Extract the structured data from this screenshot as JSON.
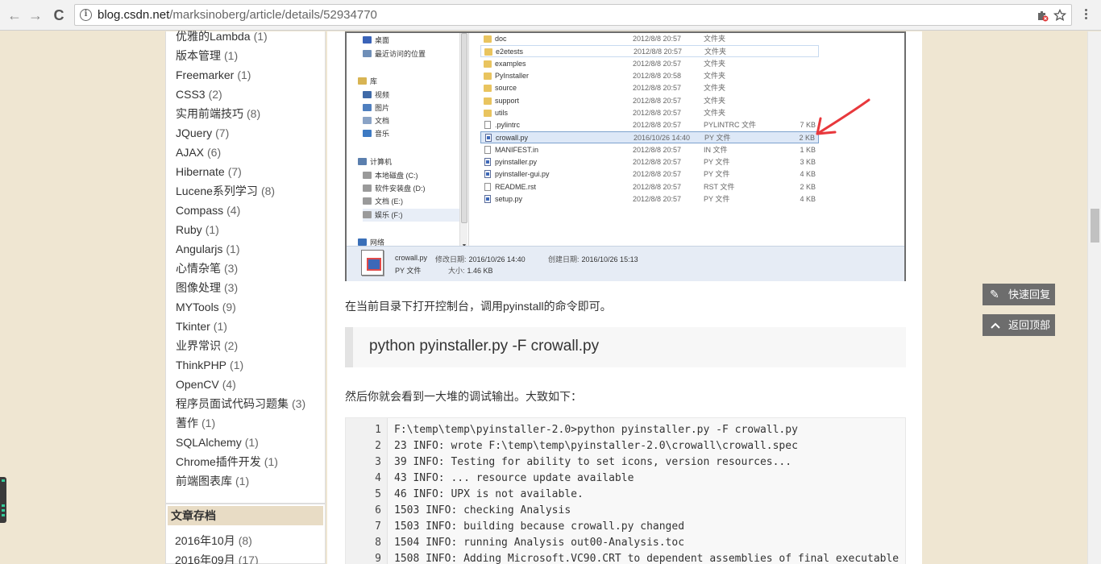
{
  "browser": {
    "url_host": "blog.csdn.net",
    "url_path": "/marksinoberg/article/details/52934770",
    "back_icon": "←",
    "forward_icon": "→",
    "reload_icon": "C"
  },
  "sidebar": {
    "categories": [
      {
        "name": "优雅的Lambda",
        "count": "(1)"
      },
      {
        "name": "版本管理",
        "count": "(1)"
      },
      {
        "name": "Freemarker",
        "count": "(1)"
      },
      {
        "name": "CSS3",
        "count": "(2)"
      },
      {
        "name": "实用前端技巧",
        "count": "(8)"
      },
      {
        "name": "JQuery",
        "count": "(7)"
      },
      {
        "name": "AJAX",
        "count": "(6)"
      },
      {
        "name": "Hibernate",
        "count": "(7)"
      },
      {
        "name": "Lucene系列学习",
        "count": "(8)"
      },
      {
        "name": "Compass",
        "count": "(4)"
      },
      {
        "name": "Ruby",
        "count": "(1)"
      },
      {
        "name": "Angularjs",
        "count": "(1)"
      },
      {
        "name": "心情杂笔",
        "count": "(3)"
      },
      {
        "name": "图像处理",
        "count": "(3)"
      },
      {
        "name": "MYTools",
        "count": "(9)"
      },
      {
        "name": "Tkinter",
        "count": "(1)"
      },
      {
        "name": "业界常识",
        "count": "(2)"
      },
      {
        "name": "ThinkPHP",
        "count": "(1)"
      },
      {
        "name": "OpenCV",
        "count": "(4)"
      },
      {
        "name": "程序员面试代码习题集",
        "count": "(3)"
      },
      {
        "name": "蓍作",
        "count": "(1)"
      },
      {
        "name": "SQLAlchemy",
        "count": "(1)"
      },
      {
        "name": "Chrome插件开发",
        "count": "(1)"
      },
      {
        "name": "前端图表库",
        "count": "(1)"
      }
    ],
    "archive_title": "文章存档",
    "archive": [
      {
        "name": "2016年10月",
        "count": "(8)"
      },
      {
        "name": "2016年09月",
        "count": "(17)"
      }
    ]
  },
  "explorer": {
    "nav": [
      {
        "label": "桌面",
        "icon": "desktop-icon",
        "color": "#3a63b8"
      },
      {
        "label": "最近访问的位置",
        "icon": "recent-places-icon",
        "color": "#6f8fb8"
      },
      {
        "label": "库",
        "icon": "library-icon",
        "color": "#d8b453"
      },
      {
        "label": "视频",
        "icon": "video-icon",
        "color": "#3f6aa8"
      },
      {
        "label": "图片",
        "icon": "pictures-icon",
        "color": "#4f7fbf"
      },
      {
        "label": "文档",
        "icon": "documents-icon",
        "color": "#8aa3c6"
      },
      {
        "label": "音乐",
        "icon": "music-icon",
        "color": "#3d7ac3"
      },
      {
        "label": "计算机",
        "icon": "computer-icon",
        "color": "#5b7fae"
      },
      {
        "label": "本地磁盘 (C:)",
        "icon": "drive-icon",
        "color": "#9a9a9a"
      },
      {
        "label": "软件安装盘 (D:)",
        "icon": "drive-icon",
        "color": "#9a9a9a"
      },
      {
        "label": "文档 (E:)",
        "icon": "drive-icon",
        "color": "#9a9a9a"
      },
      {
        "label": "娱乐 (F:)",
        "icon": "drive-icon",
        "color": "#9a9a9a"
      },
      {
        "label": "网络",
        "icon": "network-icon",
        "color": "#3a6fb8"
      }
    ],
    "files": [
      {
        "name": "doc",
        "date": "2012/8/8 20:57",
        "type": "文件夹",
        "size": "",
        "kind": "folder"
      },
      {
        "name": "e2etests",
        "date": "2012/8/8 20:57",
        "type": "文件夹",
        "size": "",
        "kind": "folder"
      },
      {
        "name": "examples",
        "date": "2012/8/8 20:57",
        "type": "文件夹",
        "size": "",
        "kind": "folder"
      },
      {
        "name": "PyInstaller",
        "date": "2012/8/8 20:58",
        "type": "文件夹",
        "size": "",
        "kind": "folder"
      },
      {
        "name": "source",
        "date": "2012/8/8 20:57",
        "type": "文件夹",
        "size": "",
        "kind": "folder"
      },
      {
        "name": "support",
        "date": "2012/8/8 20:57",
        "type": "文件夹",
        "size": "",
        "kind": "folder"
      },
      {
        "name": "utils",
        "date": "2012/8/8 20:57",
        "type": "文件夹",
        "size": "",
        "kind": "folder"
      },
      {
        "name": ".pylintrc",
        "date": "2012/8/8 20:57",
        "type": "PYLINTRC 文件",
        "size": "7 KB",
        "kind": "file"
      },
      {
        "name": "crowall.py",
        "date": "2016/10/26 14:40",
        "type": "PY 文件",
        "size": "2 KB",
        "kind": "py"
      },
      {
        "name": "MANIFEST.in",
        "date": "2012/8/8 20:57",
        "type": "IN 文件",
        "size": "1 KB",
        "kind": "file"
      },
      {
        "name": "pyinstaller.py",
        "date": "2012/8/8 20:57",
        "type": "PY 文件",
        "size": "3 KB",
        "kind": "py"
      },
      {
        "name": "pyinstaller-gui.py",
        "date": "2012/8/8 20:57",
        "type": "PY 文件",
        "size": "4 KB",
        "kind": "py"
      },
      {
        "name": "README.rst",
        "date": "2012/8/8 20:57",
        "type": "RST 文件",
        "size": "2 KB",
        "kind": "file"
      },
      {
        "name": "setup.py",
        "date": "2012/8/8 20:57",
        "type": "PY 文件",
        "size": "4 KB",
        "kind": "py"
      }
    ],
    "details": {
      "filename": "crowall.py",
      "modified_label": "修改日期:",
      "modified": "2016/10/26 14:40",
      "created_label": "创建日期:",
      "created": "2016/10/26 15:13",
      "filetype": "PY 文件",
      "size_label": "大小:",
      "size": "1.46 KB"
    },
    "arrow_color": "#e8383c"
  },
  "article": {
    "para1": "在当前目录下打开控制台，调用pyinstall的命令即可。",
    "command": "python pyinstaller.py -F crowall.py",
    "para2": "然后你就会看到一大堆的调试输出。大致如下：",
    "code": [
      {
        "n": "1",
        "t": "F:\\temp\\temp\\pyinstaller-2.0>python pyinstaller.py -F crowall.py"
      },
      {
        "n": "2",
        "t": "23 INFO: wrote F:\\temp\\temp\\pyinstaller-2.0\\crowall\\crowall.spec"
      },
      {
        "n": "3",
        "t": "39 INFO: Testing for ability to set icons, version resources..."
      },
      {
        "n": "4",
        "t": "43 INFO: ... resource update available"
      },
      {
        "n": "5",
        "t": "46 INFO: UPX is not available."
      },
      {
        "n": "6",
        "t": "1503 INFO: checking Analysis"
      },
      {
        "n": "7",
        "t": "1503 INFO: building because crowall.py changed"
      },
      {
        "n": "8",
        "t": "1504 INFO: running Analysis out00-Analysis.toc"
      },
      {
        "n": "9",
        "t": "1508 INFO: Adding Microsoft.VC90.CRT to dependent assemblies of final executable"
      }
    ]
  },
  "floating": {
    "quick_reply": "快速回复",
    "back_top": "返回顶部"
  }
}
